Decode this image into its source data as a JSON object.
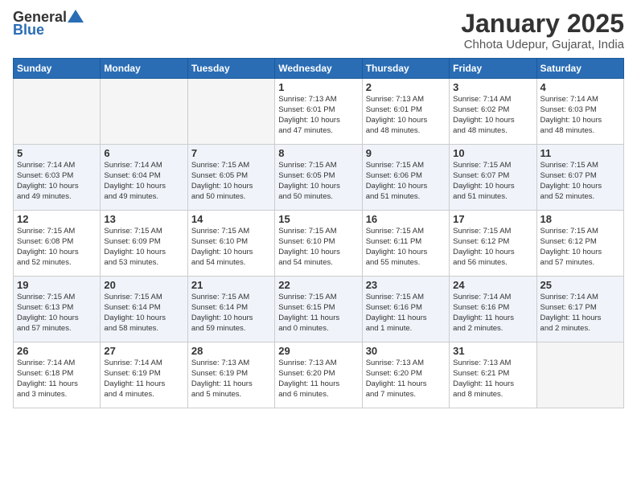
{
  "header": {
    "logo_general": "General",
    "logo_blue": "Blue",
    "title": "January 2025",
    "location": "Chhota Udepur, Gujarat, India"
  },
  "weekdays": [
    "Sunday",
    "Monday",
    "Tuesday",
    "Wednesday",
    "Thursday",
    "Friday",
    "Saturday"
  ],
  "weeks": [
    [
      {
        "day": "",
        "info": ""
      },
      {
        "day": "",
        "info": ""
      },
      {
        "day": "",
        "info": ""
      },
      {
        "day": "1",
        "info": "Sunrise: 7:13 AM\nSunset: 6:01 PM\nDaylight: 10 hours\nand 47 minutes."
      },
      {
        "day": "2",
        "info": "Sunrise: 7:13 AM\nSunset: 6:01 PM\nDaylight: 10 hours\nand 48 minutes."
      },
      {
        "day": "3",
        "info": "Sunrise: 7:14 AM\nSunset: 6:02 PM\nDaylight: 10 hours\nand 48 minutes."
      },
      {
        "day": "4",
        "info": "Sunrise: 7:14 AM\nSunset: 6:03 PM\nDaylight: 10 hours\nand 48 minutes."
      }
    ],
    [
      {
        "day": "5",
        "info": "Sunrise: 7:14 AM\nSunset: 6:03 PM\nDaylight: 10 hours\nand 49 minutes."
      },
      {
        "day": "6",
        "info": "Sunrise: 7:14 AM\nSunset: 6:04 PM\nDaylight: 10 hours\nand 49 minutes."
      },
      {
        "day": "7",
        "info": "Sunrise: 7:15 AM\nSunset: 6:05 PM\nDaylight: 10 hours\nand 50 minutes."
      },
      {
        "day": "8",
        "info": "Sunrise: 7:15 AM\nSunset: 6:05 PM\nDaylight: 10 hours\nand 50 minutes."
      },
      {
        "day": "9",
        "info": "Sunrise: 7:15 AM\nSunset: 6:06 PM\nDaylight: 10 hours\nand 51 minutes."
      },
      {
        "day": "10",
        "info": "Sunrise: 7:15 AM\nSunset: 6:07 PM\nDaylight: 10 hours\nand 51 minutes."
      },
      {
        "day": "11",
        "info": "Sunrise: 7:15 AM\nSunset: 6:07 PM\nDaylight: 10 hours\nand 52 minutes."
      }
    ],
    [
      {
        "day": "12",
        "info": "Sunrise: 7:15 AM\nSunset: 6:08 PM\nDaylight: 10 hours\nand 52 minutes."
      },
      {
        "day": "13",
        "info": "Sunrise: 7:15 AM\nSunset: 6:09 PM\nDaylight: 10 hours\nand 53 minutes."
      },
      {
        "day": "14",
        "info": "Sunrise: 7:15 AM\nSunset: 6:10 PM\nDaylight: 10 hours\nand 54 minutes."
      },
      {
        "day": "15",
        "info": "Sunrise: 7:15 AM\nSunset: 6:10 PM\nDaylight: 10 hours\nand 54 minutes."
      },
      {
        "day": "16",
        "info": "Sunrise: 7:15 AM\nSunset: 6:11 PM\nDaylight: 10 hours\nand 55 minutes."
      },
      {
        "day": "17",
        "info": "Sunrise: 7:15 AM\nSunset: 6:12 PM\nDaylight: 10 hours\nand 56 minutes."
      },
      {
        "day": "18",
        "info": "Sunrise: 7:15 AM\nSunset: 6:12 PM\nDaylight: 10 hours\nand 57 minutes."
      }
    ],
    [
      {
        "day": "19",
        "info": "Sunrise: 7:15 AM\nSunset: 6:13 PM\nDaylight: 10 hours\nand 57 minutes."
      },
      {
        "day": "20",
        "info": "Sunrise: 7:15 AM\nSunset: 6:14 PM\nDaylight: 10 hours\nand 58 minutes."
      },
      {
        "day": "21",
        "info": "Sunrise: 7:15 AM\nSunset: 6:14 PM\nDaylight: 10 hours\nand 59 minutes."
      },
      {
        "day": "22",
        "info": "Sunrise: 7:15 AM\nSunset: 6:15 PM\nDaylight: 11 hours\nand 0 minutes."
      },
      {
        "day": "23",
        "info": "Sunrise: 7:15 AM\nSunset: 6:16 PM\nDaylight: 11 hours\nand 1 minute."
      },
      {
        "day": "24",
        "info": "Sunrise: 7:14 AM\nSunset: 6:16 PM\nDaylight: 11 hours\nand 2 minutes."
      },
      {
        "day": "25",
        "info": "Sunrise: 7:14 AM\nSunset: 6:17 PM\nDaylight: 11 hours\nand 2 minutes."
      }
    ],
    [
      {
        "day": "26",
        "info": "Sunrise: 7:14 AM\nSunset: 6:18 PM\nDaylight: 11 hours\nand 3 minutes."
      },
      {
        "day": "27",
        "info": "Sunrise: 7:14 AM\nSunset: 6:19 PM\nDaylight: 11 hours\nand 4 minutes."
      },
      {
        "day": "28",
        "info": "Sunrise: 7:13 AM\nSunset: 6:19 PM\nDaylight: 11 hours\nand 5 minutes."
      },
      {
        "day": "29",
        "info": "Sunrise: 7:13 AM\nSunset: 6:20 PM\nDaylight: 11 hours\nand 6 minutes."
      },
      {
        "day": "30",
        "info": "Sunrise: 7:13 AM\nSunset: 6:20 PM\nDaylight: 11 hours\nand 7 minutes."
      },
      {
        "day": "31",
        "info": "Sunrise: 7:13 AM\nSunset: 6:21 PM\nDaylight: 11 hours\nand 8 minutes."
      },
      {
        "day": "",
        "info": ""
      }
    ]
  ]
}
